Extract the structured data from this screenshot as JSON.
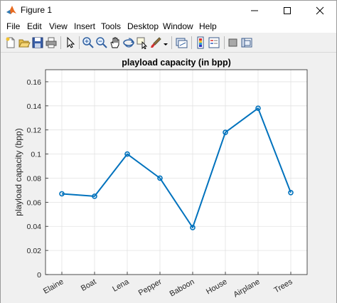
{
  "window": {
    "title": "Figure 1"
  },
  "menu": [
    "File",
    "Edit",
    "View",
    "Insert",
    "Tools",
    "Desktop",
    "Window",
    "Help"
  ],
  "toolbar": {
    "icons": [
      "new-figure-icon",
      "open-file-icon",
      "save-icon",
      "print-icon",
      "edit-plot-icon",
      "zoom-in-icon",
      "zoom-out-icon",
      "pan-icon",
      "rotate-3d-icon",
      "data-cursor-icon",
      "brush-icon",
      "brush-dropdown-icon",
      "link-plot-icon",
      "insert-colorbar-icon",
      "insert-legend-icon",
      "hide-plot-tools-icon",
      "show-plot-tools-icon"
    ]
  },
  "colors": {
    "series": "#0072bd",
    "axes_bg": "#ffffff",
    "figure_bg": "#f0f0f0"
  },
  "chart_data": {
    "type": "line",
    "title": "playload capacity (in bpp)",
    "xlabel": "",
    "ylabel": "playload capacity (bpp)",
    "categories": [
      "Elaine",
      "Boat",
      "Lena",
      "Pepper",
      "Baboon",
      "House",
      "Airplane",
      "Trees"
    ],
    "values": [
      0.067,
      0.065,
      0.1,
      0.08,
      0.039,
      0.118,
      0.138,
      0.068
    ],
    "ylim": [
      0,
      0.17
    ],
    "yticks": [
      "0",
      "0.02",
      "0.04",
      "0.06",
      "0.08",
      "0.1",
      "0.12",
      "0.14",
      "0.16"
    ],
    "grid": true,
    "marker": "circle",
    "legend": "none"
  }
}
